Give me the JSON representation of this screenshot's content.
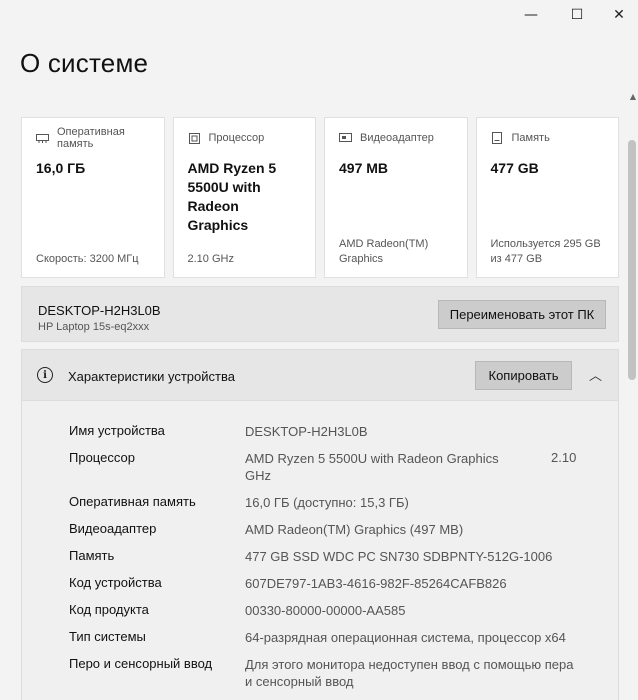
{
  "window": {
    "minimize_glyph": "—",
    "maximize_glyph": "☐",
    "close_glyph": "✕"
  },
  "page": {
    "title": "О системе"
  },
  "cards": [
    {
      "icon": "memory-icon",
      "label": "Оперативная память",
      "value": "16,0 ГБ",
      "sub": "Скорость: 3200 МГц"
    },
    {
      "icon": "processor-icon",
      "label": "Процессор",
      "value": "AMD Ryzen 5 5500U with Radeon Graphics",
      "sub": "2.10 GHz"
    },
    {
      "icon": "video-adapter-icon",
      "label": "Видеоадаптер",
      "value": "497 MB",
      "sub": "AMD Radeon(TM) Graphics"
    },
    {
      "icon": "storage-icon",
      "label": "Память",
      "value": "477 GB",
      "sub": "Используется 295 GB из 477 GB"
    }
  ],
  "pc": {
    "name": "DESKTOP-H2H3L0B",
    "model": "HP Laptop 15s-eq2xxx",
    "rename_label": "Переименовать этот ПК"
  },
  "specs": {
    "title": "Характеристики устройства",
    "copy_label": "Копировать",
    "rows": [
      {
        "label": "Имя устройства",
        "value": "DESKTOP-H2H3L0B"
      },
      {
        "label": "Процессор",
        "value": "AMD Ryzen 5 5500U with Radeon Graphics GHz",
        "value2": "2.10"
      },
      {
        "label": "Оперативная память",
        "value": "16,0 ГБ (доступно: 15,3 ГБ)"
      },
      {
        "label": "Видеоадаптер",
        "value": "AMD Radeon(TM) Graphics (497 MB)"
      },
      {
        "label": "Память",
        "value": "477 GB SSD WDC PC SN730 SDBPNTY-512G-1006"
      },
      {
        "label": "Код устройства",
        "value": "607DE797-1AB3-4616-982F-85264CAFB826"
      },
      {
        "label": "Код продукта",
        "value": "00330-80000-00000-AA585"
      },
      {
        "label": "Тип системы",
        "value": "64-разрядная операционная система, процессор x64"
      },
      {
        "label": "Перо и сенсорный ввод",
        "value": "Для этого монитора недоступен ввод с помощью пера и сенсорный ввод"
      }
    ]
  }
}
